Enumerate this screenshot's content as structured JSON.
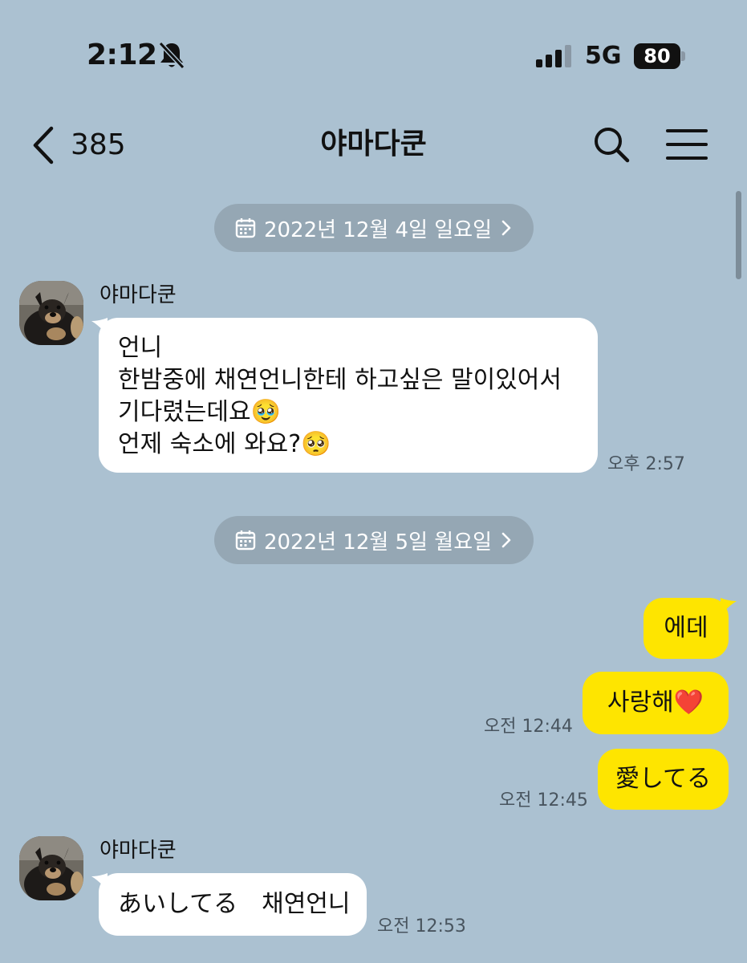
{
  "status_bar": {
    "time": "2:12",
    "network": "5G",
    "battery": "80"
  },
  "nav": {
    "back_count": "385",
    "title": "야마다쿤",
    "icons": [
      "back-chevron-icon",
      "search-icon",
      "menu-icon"
    ]
  },
  "dates": [
    {
      "label": "2022년 12월 4일 일요일"
    },
    {
      "label": "2022년 12월 5일 월요일"
    }
  ],
  "messages": [
    {
      "sender": "야마다쿤",
      "lines": [
        "언니",
        "한밤중에 채연언니한테 하고싶은 말이있어서",
        "기다렸는데요🥹",
        "언제 숙소에 와요?🥺"
      ],
      "time": "오후 2:57"
    },
    {
      "text": "에데"
    },
    {
      "text": "사랑해❤️",
      "time": "오전 12:44"
    },
    {
      "text": "愛してる",
      "time": "오전 12:45"
    },
    {
      "sender": "야마다쿤",
      "text": "あいしてる　채연언니",
      "time": "오전 12:53"
    }
  ],
  "colors": {
    "background": "#abc1d1",
    "outgoing_bubble": "#fee500",
    "incoming_bubble": "#ffffff",
    "date_chip": "#95a7b4"
  }
}
